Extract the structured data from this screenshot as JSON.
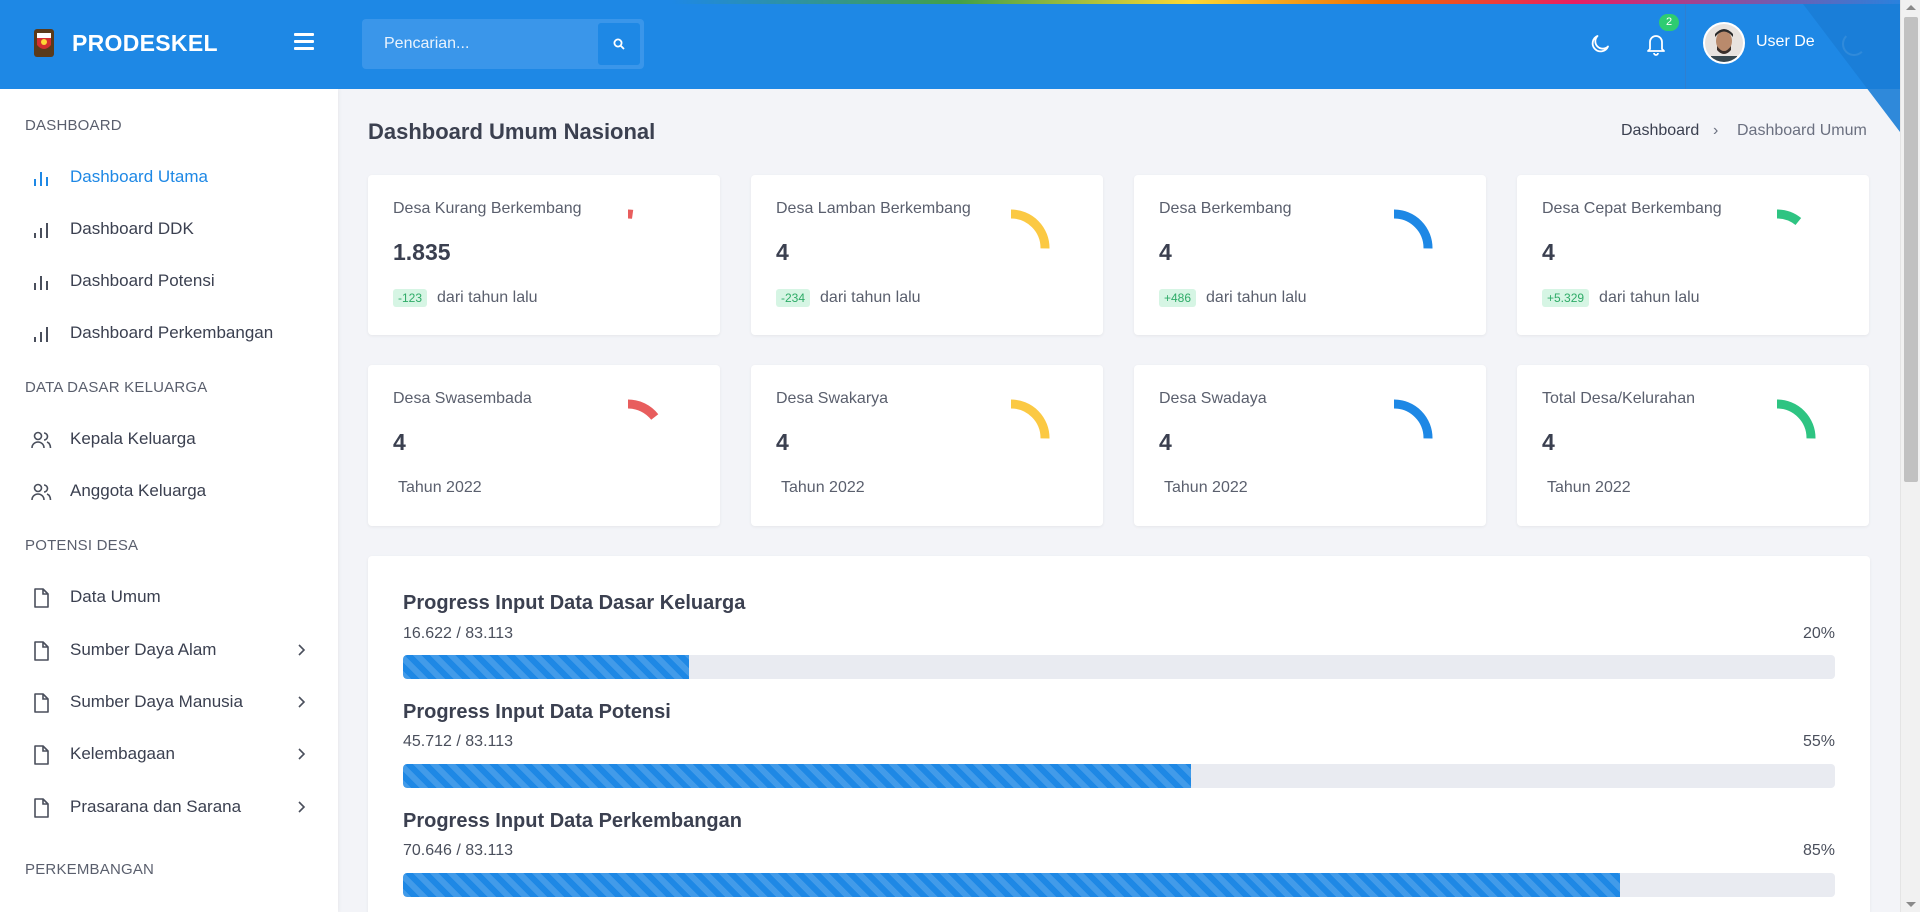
{
  "header": {
    "brand": "PRODESKEL",
    "search_placeholder": "Pencarian...",
    "notification_count": "2",
    "user_name": "User De"
  },
  "sidebar": {
    "sections": [
      {
        "title": "DASHBOARD"
      },
      {
        "title": "DATA DASAR KELUARGA"
      },
      {
        "title": "POTENSI DESA"
      },
      {
        "title": "PERKEMBANGAN"
      }
    ],
    "items": [
      {
        "label": "Dashboard Utama",
        "icon": "bar-chart-icon",
        "active": true
      },
      {
        "label": "Dashboard DDK",
        "icon": "bar-chart-icon"
      },
      {
        "label": "Dashboard Potensi",
        "icon": "bar-chart-icon"
      },
      {
        "label": "Dashboard Perkembangan",
        "icon": "bar-chart-icon"
      },
      {
        "label": "Kepala Keluarga",
        "icon": "users-icon"
      },
      {
        "label": "Anggota Keluarga",
        "icon": "users-icon"
      },
      {
        "label": "Data Umum",
        "icon": "file-icon"
      },
      {
        "label": "Sumber Daya Alam",
        "icon": "file-icon",
        "submenu": true
      },
      {
        "label": "Sumber Daya Manusia",
        "icon": "file-icon",
        "submenu": true
      },
      {
        "label": "Kelembagaan",
        "icon": "file-icon",
        "submenu": true
      },
      {
        "label": "Prasarana dan Sarana",
        "icon": "file-icon",
        "submenu": true
      }
    ]
  },
  "page": {
    "title": "Dashboard Umum Nasional",
    "breadcrumb": [
      "Dashboard",
      "Dashboard Umum"
    ],
    "breadcrumb_separator": "›"
  },
  "stats_row1": [
    {
      "title": "Desa Kurang Berkembang",
      "value": "1.835",
      "delta": "-123",
      "delta_text": "dari tahun lalu",
      "color": "#e85d5d",
      "level": 0.03
    },
    {
      "title": "Desa Lamban Berkembang",
      "value": "4",
      "delta": "-234",
      "delta_text": "dari tahun lalu",
      "color": "#fbc943",
      "level": 0.35
    },
    {
      "title": "Desa Berkembang",
      "value": "4",
      "delta": "+486",
      "delta_text": "dari tahun lalu",
      "color": "#1e88e5",
      "level": 0.35
    },
    {
      "title": "Desa Cepat Berkembang",
      "value": "4",
      "delta": "+5.329",
      "delta_text": "dari tahun lalu",
      "color": "#2ec482",
      "level": 0.15
    }
  ],
  "stats_row2": [
    {
      "title": "Desa Swasembada",
      "value": "4",
      "year": "Tahun 2022",
      "color": "#e85d5d",
      "level": 0.2
    },
    {
      "title": "Desa Swakarya",
      "value": "4",
      "year": "Tahun 2022",
      "color": "#fbc943",
      "level": 0.35
    },
    {
      "title": "Desa Swadaya",
      "value": "4",
      "year": "Tahun 2022",
      "color": "#1e88e5",
      "level": 0.35
    },
    {
      "title": "Total Desa/Kelurahan",
      "value": "4",
      "year": "Tahun 2022",
      "color": "#2ec482",
      "level": 0.35
    }
  ],
  "progress": [
    {
      "title": "Progress Input Data Dasar Keluarga",
      "count": "16.622 / 83.113",
      "percent_label": "20%",
      "fraction": 0.2
    },
    {
      "title": "Progress Input Data Potensi",
      "count": "45.712 / 83.113",
      "percent_label": "55%",
      "fraction": 0.55
    },
    {
      "title": "Progress Input Data Perkembangan",
      "count": "70.646 / 83.113",
      "percent_label": "85%",
      "fraction": 0.85
    }
  ],
  "colors": {
    "primary": "#1e88e5",
    "success": "#2ecc71"
  }
}
